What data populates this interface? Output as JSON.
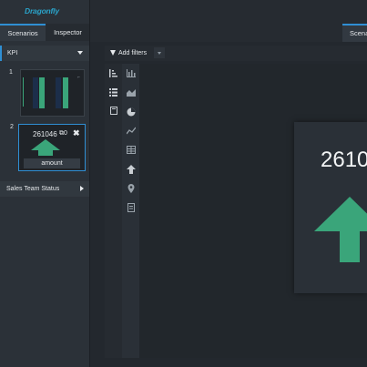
{
  "app": {
    "logo_text": "Dragonfly"
  },
  "left_panel": {
    "tabs": [
      {
        "label": "Scenarios",
        "active": true
      },
      {
        "label": "Inspector",
        "active": false
      }
    ],
    "kpi_section": {
      "label": "KPI"
    },
    "thumbnails": [
      {
        "number": "1"
      },
      {
        "number": "2",
        "value": "261046",
        "icons_text": "⧉0",
        "field_label": "amount"
      }
    ],
    "sales_section": {
      "label": "Sales Team Status"
    }
  },
  "top_bar": {
    "tab_label": "Scena"
  },
  "filter_bar": {
    "add_filters_label": "Add filters"
  },
  "toolbar_left": [
    {
      "icon": "sort-icon"
    },
    {
      "icon": "list-icon"
    },
    {
      "icon": "book-icon"
    }
  ],
  "toolbar_chart_types": [
    {
      "icon": "bar-chart-icon"
    },
    {
      "icon": "area-chart-icon"
    },
    {
      "icon": "pie-chart-icon"
    },
    {
      "icon": "line-chart-icon"
    },
    {
      "icon": "table-icon"
    },
    {
      "icon": "kpi-arrow-icon"
    },
    {
      "icon": "map-pin-icon"
    },
    {
      "icon": "file-icon"
    }
  ],
  "kpi_card": {
    "value": "2610",
    "trend": "up"
  },
  "colors": {
    "accent": "#2f8fd4",
    "positive": "#3aa57a",
    "logo": "#2aa3c9"
  }
}
